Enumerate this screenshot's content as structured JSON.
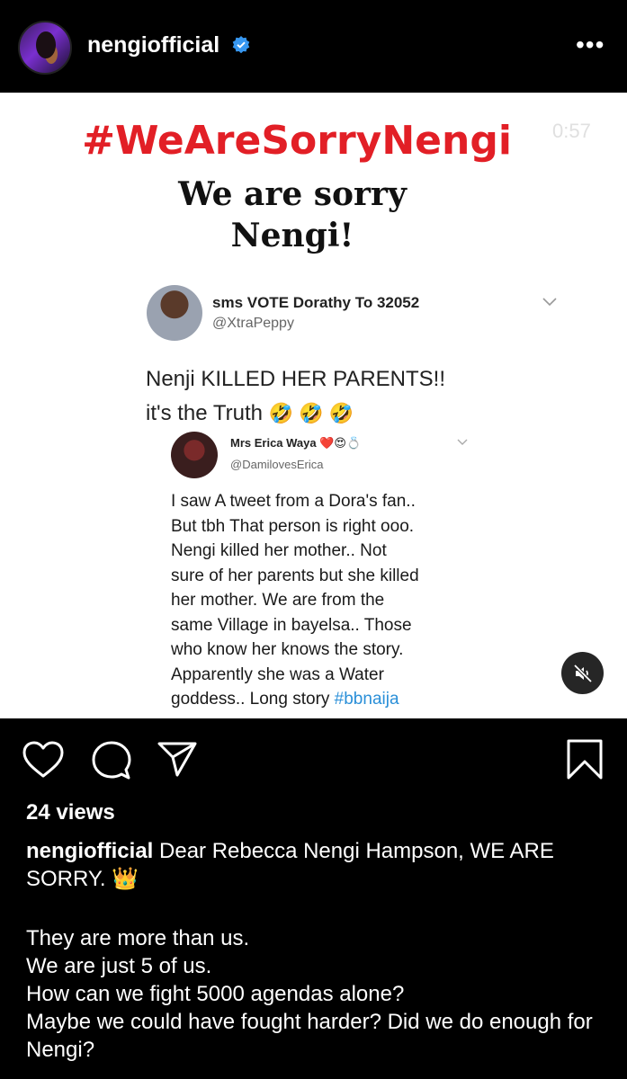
{
  "header": {
    "username": "nengiofficial",
    "more_label": "•••"
  },
  "media": {
    "timer": "0:57",
    "hashtag_title": "#WeAreSorryNengi",
    "title_line1": "We are sorry",
    "title_line2": "Nengi!",
    "tweet1": {
      "name": "sms VOTE Dorathy To 32052",
      "handle": "@XtraPeppy",
      "text_line1": "Nenji KILLED HER PARENTS!!",
      "text_line2": "it's the Truth",
      "emojis": "🤣 🤣 🤣"
    },
    "tweet2": {
      "name": "Mrs Erica Waya",
      "name_emojis": "❤️😍💍",
      "handle": "@DamilovesErica",
      "body_lines": [
        "I saw A tweet from a Dora's fan..",
        "But tbh That person is right ooo.",
        "Nengi killed her mother.. Not",
        "sure of her parents but she killed",
        "her mother. We are from the",
        "same Village in bayelsa.. Those",
        "who know her knows the story.",
        "Apparently she was a Water"
      ],
      "last_line_text": "goddess.. Long story ",
      "last_line_hashtag": "#bbnaija"
    }
  },
  "post": {
    "views": "24 views",
    "caption_user": "nengiofficial",
    "caption_first": " Dear Rebecca Nengi Hampson, WE ARE SORRY. 👑",
    "caption_lines": [
      "They are more than us.",
      "We are just 5 of us.",
      "How can we fight 5000 agendas alone?",
      "Maybe we could have fought harder? Did we do enough for Nengi?"
    ]
  },
  "colors": {
    "hashtag_red": "#e21f26",
    "verified_blue": "#3797f0",
    "link_blue": "#2a8fd8"
  }
}
